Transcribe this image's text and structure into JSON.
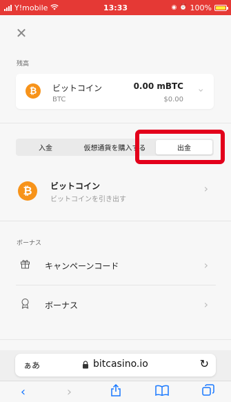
{
  "status_bar": {
    "carrier": "Y!mobile",
    "time": "13:33",
    "battery": "100%"
  },
  "balance": {
    "label": "残高",
    "coin_name": "ビットコイン",
    "coin_symbol": "BTC",
    "amount": "0.00 mBTC",
    "usd": "$0.00"
  },
  "tabs": [
    {
      "label": "入金",
      "active": false
    },
    {
      "label": "仮想通貨を購入する",
      "active": false
    },
    {
      "label": "出金",
      "active": true
    }
  ],
  "withdraw_item": {
    "title": "ビットコイン",
    "subtitle": "ビットコインを引き出す"
  },
  "bonus_section": {
    "label": "ボーナス",
    "items": [
      {
        "label": "キャンペーンコード",
        "icon": "gift-icon"
      },
      {
        "label": "ボーナス",
        "icon": "badge-icon"
      }
    ]
  },
  "address_bar": {
    "text_size": "ぁあ",
    "url": "bitcasino.io"
  },
  "colors": {
    "status_bar": "#e53935",
    "bitcoin": "#f7931a",
    "highlight": "#e3001b",
    "ios_blue": "#1677ff"
  }
}
